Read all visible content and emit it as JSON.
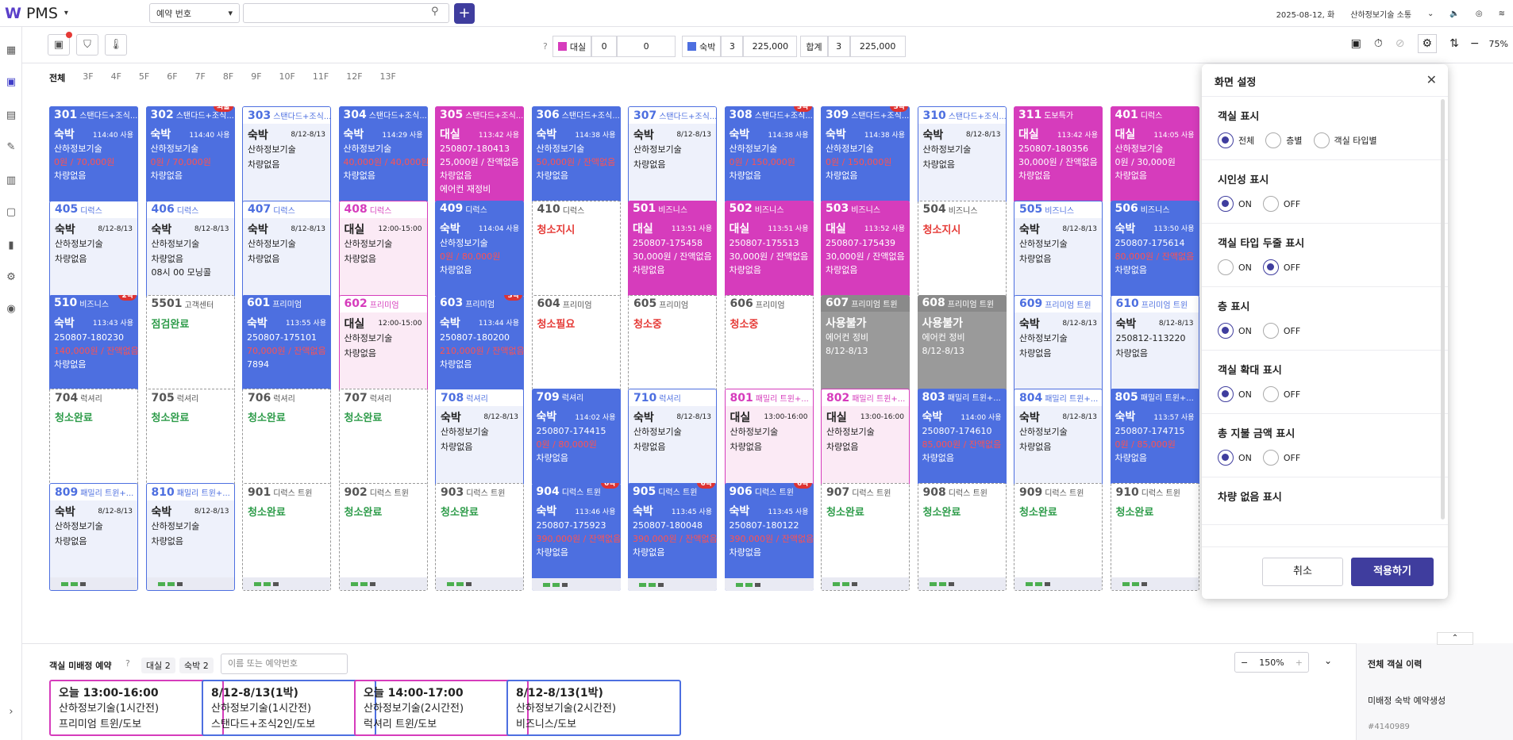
{
  "app": {
    "logo": "W",
    "name": "PMS"
  },
  "search": {
    "select_label": "예약 번호",
    "placeholder": ""
  },
  "top_right": {
    "date": "2025-08-12, 화",
    "company": "산하정보기술 소통"
  },
  "summary": {
    "vacancy_label": "대실",
    "vacancy_count": "0",
    "vacancy_amount": "0",
    "stay_label": "숙박",
    "stay_count": "3",
    "stay_amount": "225,000",
    "total_label": "합계",
    "total_count": "3",
    "total_amount": "225,000",
    "colors": {
      "vacancy": "#d63cbc",
      "stay": "#4d6fe0"
    }
  },
  "zoom_level": "75%",
  "floors": [
    "전체",
    "3F",
    "4F",
    "5F",
    "6F",
    "7F",
    "8F",
    "9F",
    "10F",
    "11F",
    "12F",
    "13F"
  ],
  "rooms": [
    {
      "no": "301",
      "type": "스탠다드+조식...",
      "style": "t-blue",
      "kind": "숙박",
      "time": "114:40 사용",
      "guest": "산하정보기술",
      "l3": "0원 / 70,000원",
      "l3red": true,
      "l4": "차량없음"
    },
    {
      "no": "302",
      "type": "스탠다드+조식...",
      "style": "t-blue",
      "kind": "숙박",
      "time": "114:40 사용",
      "guest": "산하정보기술",
      "l3": "0원 / 70,000원",
      "l3red": true,
      "l4": "차량없음",
      "badge": "외출"
    },
    {
      "no": "303",
      "type": "스탠다드+조식...",
      "style": "t-light",
      "kind": "숙박",
      "time": "8/12-8/13",
      "guest": "산하정보기술",
      "l3": "",
      "l4": "차량없음"
    },
    {
      "no": "304",
      "type": "스탠다드+조식...",
      "style": "t-blue",
      "kind": "숙박",
      "time": "114:29 사용",
      "guest": "산하정보기술",
      "l3": "40,000원 / 40,000원",
      "l3red": true,
      "l4": "차량없음"
    },
    {
      "no": "305",
      "type": "스탠다드+조식...",
      "style": "t-mag",
      "kind": "대실",
      "time": "113:42 사용",
      "guest": "250807-180413",
      "l3": "25,000원 / 잔액없음",
      "l4": "차량없음",
      "l5": "에어컨 재정비"
    },
    {
      "no": "306",
      "type": "스탠다드+조식...",
      "style": "t-blue",
      "kind": "숙박",
      "time": "114:38 사용",
      "guest": "산하정보기술",
      "l3": "50,000원 / 잔액없음",
      "l3red": true,
      "l4": "차량없음"
    },
    {
      "no": "307",
      "type": "스탠다드+조식...",
      "style": "t-light",
      "kind": "숙박",
      "time": "8/12-8/13",
      "guest": "산하정보기술",
      "l3": "",
      "l4": "차량없음"
    },
    {
      "no": "308",
      "type": "스탠다드+조식...",
      "style": "t-blue",
      "kind": "숙박",
      "time": "114:38 사용",
      "guest": "산하정보기술",
      "l3": "0원 / 150,000원",
      "l3red": true,
      "l4": "차량없음",
      "badge": "3박"
    },
    {
      "no": "309",
      "type": "스탠다드+조식...",
      "style": "t-blue",
      "kind": "숙박",
      "time": "114:38 사용",
      "guest": "산하정보기술",
      "l3": "0원 / 150,000원",
      "l3red": true,
      "l4": "차량없음",
      "badge": "3박"
    },
    {
      "no": "310",
      "type": "스탠다드+조식...",
      "style": "t-light",
      "kind": "숙박",
      "time": "8/12-8/13",
      "guest": "산하정보기술",
      "l3": "",
      "l4": "차량없음"
    },
    {
      "no": "311",
      "type": "도보특가",
      "style": "t-mag",
      "kind": "대실",
      "time": "113:42 사용",
      "guest": "250807-180356",
      "l3": "30,000원 / 잔액없음",
      "l4": "차량없음"
    },
    {
      "no": "401",
      "type": "디럭스",
      "style": "t-mag",
      "kind": "대실",
      "time": "114:05 사용",
      "guest": "산하정보기술",
      "l3": "0원 / 30,000원",
      "l4": "차량없음"
    },
    {
      "no": "405",
      "type": "디럭스",
      "style": "t-light",
      "kind": "숙박",
      "time": "8/12-8/13",
      "guest": "산하정보기술",
      "l3": "",
      "l4": "차량없음"
    },
    {
      "no": "406",
      "type": "디럭스",
      "style": "t-light",
      "kind": "숙박",
      "time": "8/12-8/13",
      "guest": "산하정보기술",
      "l3": "",
      "l4": "차량없음",
      "l5": "08시 00 모닝콜"
    },
    {
      "no": "407",
      "type": "디럭스",
      "style": "t-light",
      "kind": "숙박",
      "time": "8/12-8/13",
      "guest": "산하정보기술",
      "l3": "",
      "l4": "차량없음"
    },
    {
      "no": "408",
      "type": "디럭스",
      "style": "t-pinkl",
      "kind": "대실",
      "time": "12:00-15:00",
      "guest": "산하정보기술",
      "l3": "",
      "l4": "차량없음"
    },
    {
      "no": "409",
      "type": "디럭스",
      "style": "t-blue",
      "kind": "숙박",
      "time": "114:04 사용",
      "guest": "산하정보기술",
      "l3": "0원 / 80,000원",
      "l3red": true,
      "l4": "차량없음"
    },
    {
      "no": "410",
      "type": "디럭스",
      "style": "t-dash",
      "status": "청소지시",
      "statusRed": true
    },
    {
      "no": "501",
      "type": "비즈니스",
      "style": "t-mag",
      "kind": "대실",
      "time": "113:51 사용",
      "guest": "250807-175458",
      "l3": "30,000원 / 잔액없음",
      "l4": "차량없음"
    },
    {
      "no": "502",
      "type": "비즈니스",
      "style": "t-mag",
      "kind": "대실",
      "time": "113:51 사용",
      "guest": "250807-175513",
      "l3": "30,000원 / 잔액없음",
      "l4": "차량없음"
    },
    {
      "no": "503",
      "type": "비즈니스",
      "style": "t-mag",
      "kind": "대실",
      "time": "113:52 사용",
      "guest": "250807-175439",
      "l3": "30,000원 / 잔액없음",
      "l4": "차량없음"
    },
    {
      "no": "504",
      "type": "비즈니스",
      "style": "t-dash",
      "status": "청소지시",
      "statusRed": true
    },
    {
      "no": "505",
      "type": "비즈니스",
      "style": "t-light",
      "kind": "숙박",
      "time": "8/12-8/13",
      "guest": "산하정보기술",
      "l3": "",
      "l4": "차량없음"
    },
    {
      "no": "506",
      "type": "비즈니스",
      "style": "t-blue",
      "kind": "숙박",
      "time": "113:50 사용",
      "guest": "250807-175614",
      "l3": "80,000원 / 잔액없음",
      "l3red": true,
      "l4": "차량없음"
    },
    {
      "no": "510",
      "type": "비즈니스",
      "style": "t-blue",
      "kind": "숙박",
      "time": "113:43 사용",
      "guest": "250807-180230",
      "l3": "140,000원 / 잔액없음",
      "l3red": true,
      "l4": "차량없음",
      "badge": "2박"
    },
    {
      "no": "5501",
      "type": "고객센터",
      "style": "t-dash",
      "status": "점검완료",
      "statusRed": false
    },
    {
      "no": "601",
      "type": "프리미엄",
      "style": "t-blue",
      "kind": "숙박",
      "time": "113:55 사용",
      "guest": "250807-175101",
      "l3": "70,000원 / 잔액없음",
      "l3red": true,
      "l4": "7894"
    },
    {
      "no": "602",
      "type": "프리미엄",
      "style": "t-pinkl",
      "kind": "대실",
      "time": "12:00-15:00",
      "guest": "산하정보기술",
      "l3": "",
      "l4": "차량없음"
    },
    {
      "no": "603",
      "type": "프리미엄",
      "style": "t-blue",
      "kind": "숙박",
      "time": "113:44 사용",
      "guest": "250807-180200",
      "l3": "210,000원 / 잔액없음",
      "l3red": true,
      "l4": "차량없음",
      "badge": "3박"
    },
    {
      "no": "604",
      "type": "프리미엄",
      "style": "t-dash",
      "status": "청소필요",
      "statusRed": true
    },
    {
      "no": "605",
      "type": "프리미엄",
      "style": "t-dash",
      "status": "청소중",
      "statusRed": true
    },
    {
      "no": "606",
      "type": "프리미엄",
      "style": "t-dash",
      "status": "청소중",
      "statusRed": true
    },
    {
      "no": "607",
      "type": "프리미엄 트윈",
      "style": "t-gray",
      "kind": "사용불가",
      "time": "",
      "guest": "에어컨 정비",
      "l3": "8/12-8/13",
      "l4": ""
    },
    {
      "no": "608",
      "type": "프리미엄 트윈",
      "style": "t-gray",
      "kind": "사용불가",
      "time": "",
      "guest": "에어컨 정비",
      "l3": "8/12-8/13",
      "l4": ""
    },
    {
      "no": "609",
      "type": "프리미엄 트윈",
      "style": "t-light",
      "kind": "숙박",
      "time": "8/12-8/13",
      "guest": "산하정보기술",
      "l3": "",
      "l4": "차량없음"
    },
    {
      "no": "610",
      "type": "프리미엄 트윈",
      "style": "t-light",
      "kind": "숙박",
      "time": "8/12-8/13",
      "guest": "250812-113220",
      "l3": "",
      "l4": "차량없음"
    },
    {
      "no": "704",
      "type": "럭셔리",
      "style": "t-dash",
      "status": "청소완료",
      "statusRed": false
    },
    {
      "no": "705",
      "type": "럭셔리",
      "style": "t-dash",
      "status": "청소완료",
      "statusRed": false
    },
    {
      "no": "706",
      "type": "럭셔리",
      "style": "t-dash",
      "status": "청소완료",
      "statusRed": false
    },
    {
      "no": "707",
      "type": "럭셔리",
      "style": "t-dash",
      "status": "청소완료",
      "statusRed": false
    },
    {
      "no": "708",
      "type": "럭셔리",
      "style": "t-light",
      "kind": "숙박",
      "time": "8/12-8/13",
      "guest": "산하정보기술",
      "l3": "",
      "l4": "차량없음"
    },
    {
      "no": "709",
      "type": "럭셔리",
      "style": "t-blue",
      "kind": "숙박",
      "time": "114:02 사용",
      "guest": "250807-174415",
      "l3": "0원 / 80,000원",
      "l3red": true,
      "l4": "차량없음"
    },
    {
      "no": "710",
      "type": "럭셔리",
      "style": "t-light",
      "kind": "숙박",
      "time": "8/12-8/13",
      "guest": "산하정보기술",
      "l3": "",
      "l4": "차량없음"
    },
    {
      "no": "801",
      "type": "패밀리 트윈+...",
      "style": "t-pinkl",
      "kind": "대실",
      "time": "13:00-16:00",
      "guest": "산하정보기술",
      "l3": "",
      "l4": "차량없음"
    },
    {
      "no": "802",
      "type": "패밀리 트윈+...",
      "style": "t-pinkl",
      "kind": "대실",
      "time": "13:00-16:00",
      "guest": "산하정보기술",
      "l3": "",
      "l4": "차량없음"
    },
    {
      "no": "803",
      "type": "패밀리 트윈+...",
      "style": "t-blue",
      "kind": "숙박",
      "time": "114:00 사용",
      "guest": "250807-174610",
      "l3": "85,000원 / 잔액없음",
      "l3red": true,
      "l4": "차량없음"
    },
    {
      "no": "804",
      "type": "패밀리 트윈+...",
      "style": "t-light",
      "kind": "숙박",
      "time": "8/12-8/13",
      "guest": "산하정보기술",
      "l3": "",
      "l4": "차량없음"
    },
    {
      "no": "805",
      "type": "패밀리 트윈+...",
      "style": "t-blue",
      "kind": "숙박",
      "time": "113:57 사용",
      "guest": "250807-174715",
      "l3": "0원 / 85,000원",
      "l3red": true,
      "l4": "차량없음"
    },
    {
      "no": "809",
      "type": "패밀리 트윈+...",
      "style": "t-light",
      "kind": "숙박",
      "time": "8/12-8/13",
      "guest": "산하정보기술",
      "l3": "",
      "l4": "차량없음"
    },
    {
      "no": "810",
      "type": "패밀리 트윈+...",
      "style": "t-light",
      "kind": "숙박",
      "time": "8/12-8/13",
      "guest": "산하정보기술",
      "l3": "",
      "l4": "차량없음"
    },
    {
      "no": "901",
      "type": "디럭스 트윈",
      "style": "t-dash",
      "status": "청소완료",
      "statusRed": false
    },
    {
      "no": "902",
      "type": "디럭스 트윈",
      "style": "t-dash",
      "status": "청소완료",
      "statusRed": false
    },
    {
      "no": "903",
      "type": "디럭스 트윈",
      "style": "t-dash",
      "status": "청소완료",
      "statusRed": false
    },
    {
      "no": "904",
      "type": "디럭스 트윈",
      "style": "t-blue",
      "kind": "숙박",
      "time": "113:46 사용",
      "guest": "250807-175923",
      "l3": "390,000원 / 잔액없음",
      "l3red": true,
      "l4": "차량없음",
      "badge": "6박"
    },
    {
      "no": "905",
      "type": "디럭스 트윈",
      "style": "t-blue",
      "kind": "숙박",
      "time": "113:45 사용",
      "guest": "250807-180048",
      "l3": "390,000원 / 잔액없음",
      "l3red": true,
      "l4": "차량없음",
      "badge": "6박"
    },
    {
      "no": "906",
      "type": "디럭스 트윈",
      "style": "t-blue",
      "kind": "숙박",
      "time": "113:45 사용",
      "guest": "250807-180122",
      "l3": "390,000원 / 잔액없음",
      "l3red": true,
      "l4": "차량없음",
      "badge": "6박"
    },
    {
      "no": "907",
      "type": "디럭스 트윈",
      "style": "t-dash",
      "status": "청소완료",
      "statusRed": false
    },
    {
      "no": "908",
      "type": "디럭스 트윈",
      "style": "t-dash",
      "status": "청소완료",
      "statusRed": false
    },
    {
      "no": "909",
      "type": "디럭스 트윈",
      "style": "t-dash",
      "status": "청소완료",
      "statusRed": false
    },
    {
      "no": "910",
      "type": "디럭스 트윈",
      "style": "t-dash",
      "status": "청소완료",
      "statusRed": false
    }
  ],
  "bottom": {
    "title": "객실 미배정 예약",
    "tag1": "대실 2",
    "tag2": "숙박 2",
    "search_placeholder": "이름 또는 예약번호",
    "zoom": "150%",
    "pending": [
      {
        "l1": "오늘 13:00-16:00",
        "l2": "산하정보기술(1시간전)",
        "l3": "프리미엄 트윈/도보",
        "style": "pend-m"
      },
      {
        "l1": "8/12-8/13(1박)",
        "l2": "산하정보기술(1시간전)",
        "l3": "스탠다드+조식2인/도보",
        "style": "pend-b"
      },
      {
        "l1": "오늘 14:00-17:00",
        "l2": "산하정보기술(2시간전)",
        "l3": "럭셔리 트윈/도보",
        "style": "pend-m"
      },
      {
        "l1": "8/12-8/13(1박)",
        "l2": "산하정보기술(2시간전)",
        "l3": "비즈니스/도보",
        "style": "pend-b"
      }
    ]
  },
  "history": {
    "title": "전체 객실 이력",
    "item": "미배정 숙박 예약생성",
    "id": "#4140989"
  },
  "panel": {
    "title": "화면 설정",
    "sections": [
      {
        "label": "객실 표시",
        "options": [
          "전체",
          "층별",
          "객실 타입별"
        ],
        "selected": 0
      },
      {
        "label": "시인성 표시",
        "options": [
          "ON",
          "OFF"
        ],
        "selected": 0
      },
      {
        "label": "객실 타입 두줄 표시",
        "options": [
          "ON",
          "OFF"
        ],
        "selected": 1
      },
      {
        "label": "층 표시",
        "options": [
          "ON",
          "OFF"
        ],
        "selected": 0
      },
      {
        "label": "객실 확대 표시",
        "options": [
          "ON",
          "OFF"
        ],
        "selected": 0
      },
      {
        "label": "총 지불 금액 표시",
        "options": [
          "ON",
          "OFF"
        ],
        "selected": 0
      },
      {
        "label": "차량 없음 표시",
        "options": [],
        "selected": -1
      }
    ],
    "cancel": "취소",
    "apply": "적용하기"
  }
}
